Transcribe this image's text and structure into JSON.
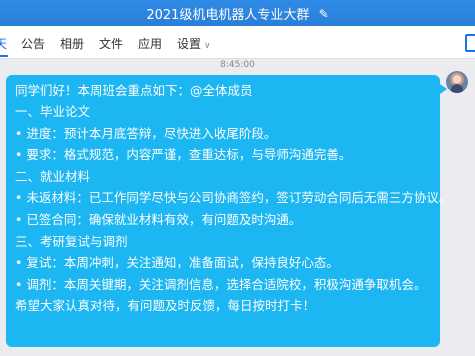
{
  "titlebar": {
    "title": "2021级机电机器人专业大群",
    "edit_icon": "pencil-icon"
  },
  "tabs": [
    {
      "label": "天"
    },
    {
      "label": "公告"
    },
    {
      "label": "相册"
    },
    {
      "label": "文件"
    },
    {
      "label": "应用"
    },
    {
      "label": "设置"
    }
  ],
  "settings_chevron": "chevron-down-icon",
  "message": {
    "time": "8:45:00",
    "lines": [
      "同学们好！本周班会重点如下：@全体成员",
      "一、毕业论文",
      "• 进度：预计本月底答辩，尽快进入收尾阶段。",
      "• 要求：格式规范，内容严谨，查重达标，与导师沟通完善。",
      "二、就业材料",
      "• 未返材料：已工作同学尽快与公司协商签约，签订劳动合同后无需三方协议。",
      "• 已签合同：确保就业材料有效，有问题及时沟通。",
      "三、考研复试与调剂",
      "• 复试：本周冲刺，关注通知，准备面试，保持良好心态。",
      "• 调剂：本周关键期，关注调剂信息，选择合适院校，积极沟通争取机会。",
      "希望大家认真对待，有问题及时反馈，每日按时打卡！"
    ]
  },
  "colors": {
    "bubble": "#1cb6f2",
    "accent": "#1a73e8",
    "titlebar": "#2f8be6"
  }
}
